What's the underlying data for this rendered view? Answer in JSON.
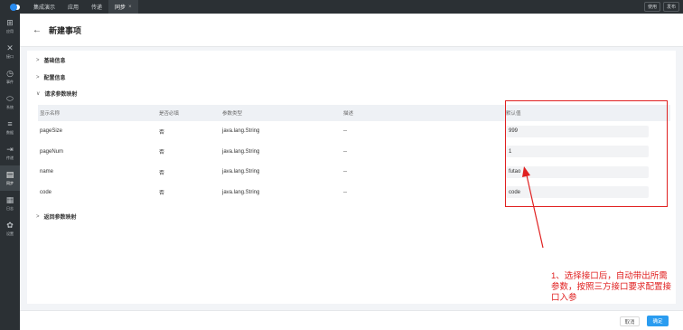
{
  "topbar": {
    "tabs": [
      {
        "label": "集成演示",
        "active": false
      },
      {
        "label": "应用",
        "active": false
      },
      {
        "label": "传递",
        "active": false
      },
      {
        "label": "同步",
        "active": true
      }
    ],
    "close_glyph": "×",
    "right_buttons": [
      "使用",
      "发布"
    ]
  },
  "sidebar": {
    "items": [
      {
        "icon": "grid-icon",
        "glyph": "⊞",
        "label": "应用"
      },
      {
        "icon": "tools-icon",
        "glyph": "✕",
        "label": "接口"
      },
      {
        "icon": "clock-icon",
        "glyph": "◷",
        "label": "事件"
      },
      {
        "icon": "tag-icon",
        "glyph": "⬭",
        "label": "系统"
      },
      {
        "icon": "list-icon",
        "glyph": "≡",
        "label": "数据"
      },
      {
        "icon": "import-icon",
        "glyph": "⇥",
        "label": "传递"
      },
      {
        "icon": "sync-icon",
        "glyph": "▤",
        "label": "同步",
        "active": true
      },
      {
        "icon": "doc-icon",
        "glyph": "▦",
        "label": "日志"
      },
      {
        "icon": "settings-icon",
        "glyph": "✿",
        "label": "设置"
      }
    ]
  },
  "header": {
    "back": "←",
    "title": "新建事项"
  },
  "sections": {
    "basic": {
      "chev": ">",
      "label": "基础信息"
    },
    "config": {
      "chev": ">",
      "label": "配置信息"
    },
    "request": {
      "chev": "∨",
      "label": "请求参数映射"
    },
    "response": {
      "chev": ">",
      "label": "返回参数映射"
    }
  },
  "table": {
    "headers": [
      "显示名称",
      "是否必填",
      "参数类型",
      "描述",
      "默认值"
    ],
    "rows": [
      {
        "name": "pageSize",
        "required": "否",
        "type": "java.lang.String",
        "desc": "--",
        "default": "999"
      },
      {
        "name": "pageNum",
        "required": "否",
        "type": "java.lang.String",
        "desc": "--",
        "default": "1"
      },
      {
        "name": "name",
        "required": "否",
        "type": "java.lang.String",
        "desc": "--",
        "default": "futao"
      },
      {
        "name": "code",
        "required": "否",
        "type": "java.lang.String",
        "desc": "--",
        "default": "code"
      }
    ]
  },
  "footer": {
    "cancel": "取消",
    "ok": "确定"
  },
  "annotation": {
    "lines": [
      "1、选择接口后，自动带出所需",
      "参数，按照三方接口要求配置接",
      "口入参"
    ],
    "color": "#e02020"
  }
}
